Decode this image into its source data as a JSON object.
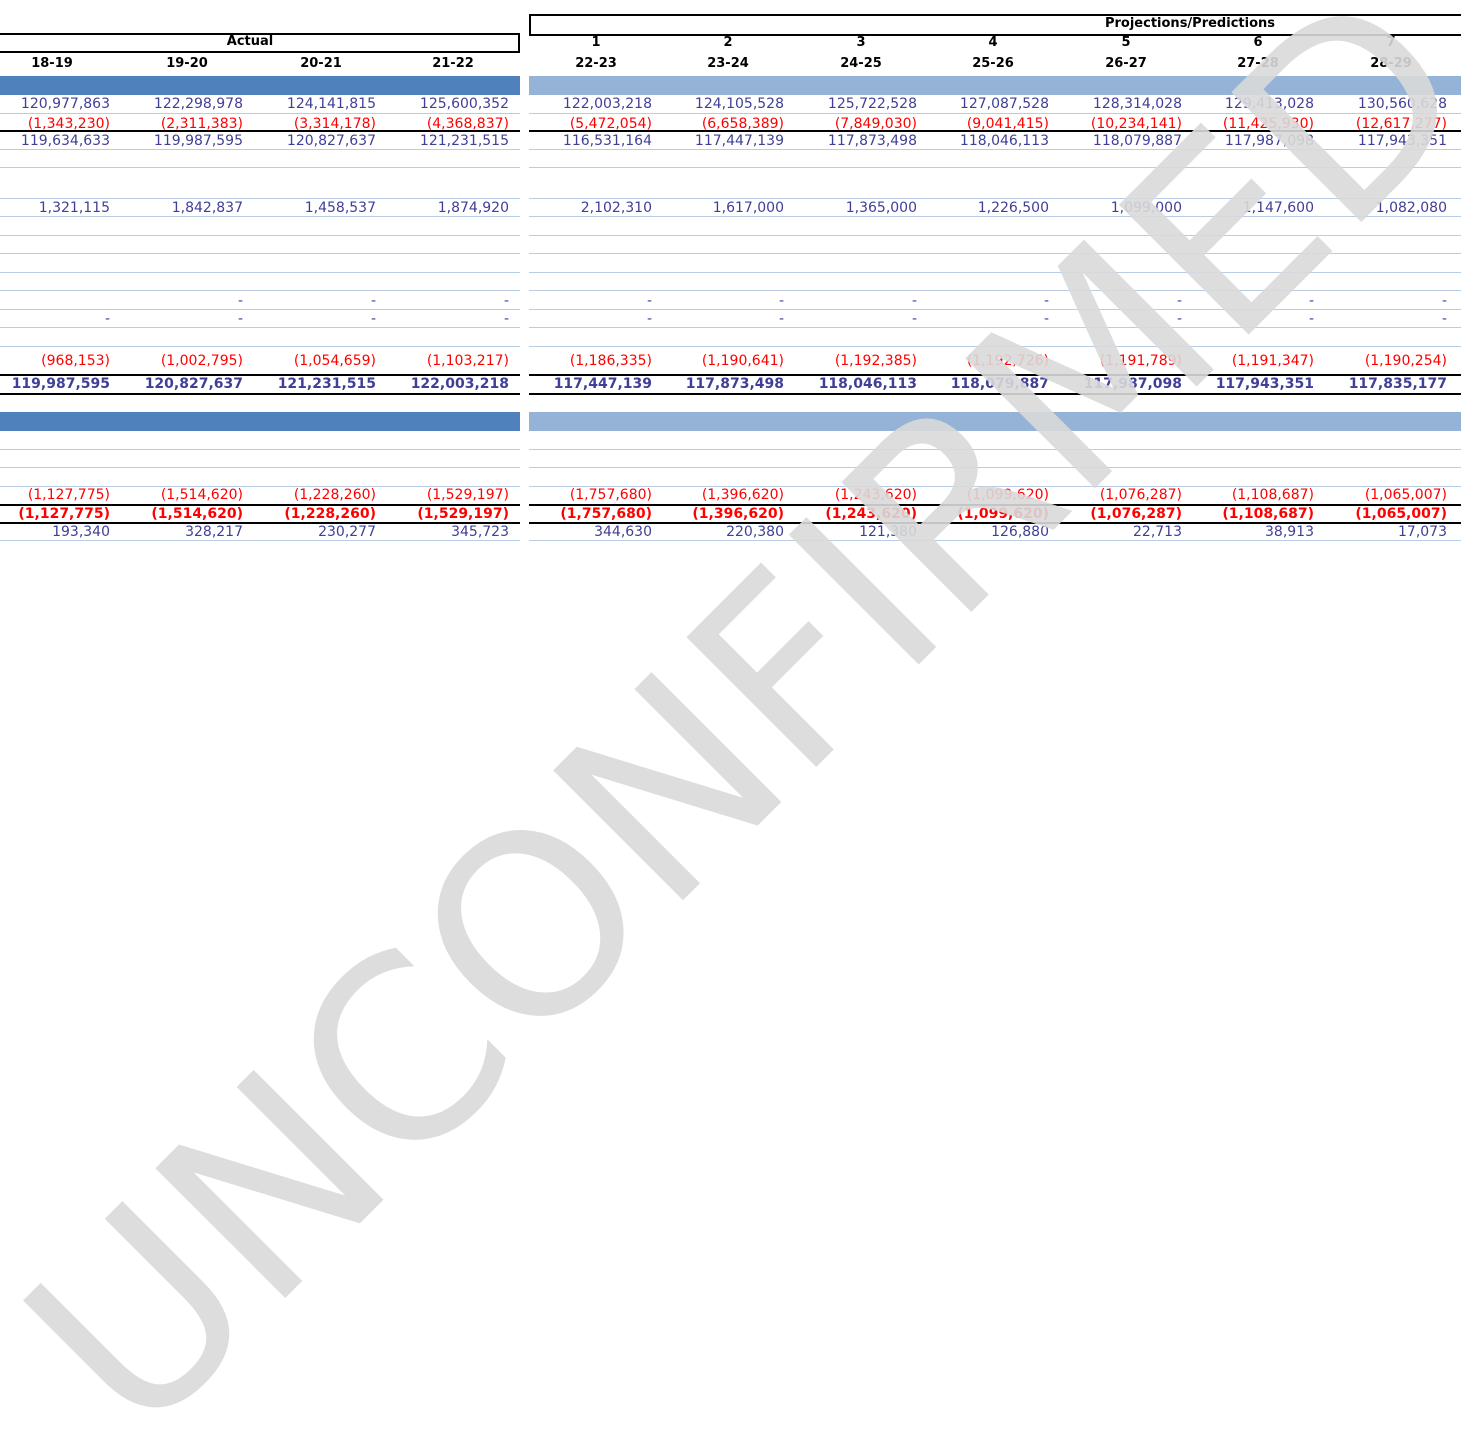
{
  "headers": {
    "actual_label": "Actual",
    "projections_label": "Projections/Predictions",
    "period_numbers": [
      "1",
      "2",
      "3",
      "4",
      "5",
      "6",
      "7"
    ],
    "years": [
      "18-19",
      "19-20",
      "20-21",
      "21-22",
      "22-23",
      "23-24",
      "24-25",
      "25-26",
      "26-27",
      "27-28",
      "28-29"
    ]
  },
  "colors": {
    "actual_band": "#4f81bd",
    "projection_band": "#95b3d7",
    "blue_text": "#3f3f97",
    "red_text": "#ff0000",
    "grid_line": "#b8cce4",
    "watermark": "#d9d9d9"
  },
  "rows": [
    {
      "style": "blue",
      "values": [
        "120,977,863",
        "122,298,978",
        "124,141,815",
        "125,600,352",
        "122,003,218",
        "124,105,528",
        "125,722,528",
        "127,087,528",
        "128,314,028",
        "129,413,028",
        "130,560,628"
      ]
    },
    {
      "style": "red",
      "values": [
        "(1,343,230)",
        "(2,311,383)",
        "(3,314,178)",
        "(4,368,837)",
        "(5,472,054)",
        "(6,658,389)",
        "(7,849,030)",
        "(9,041,415)",
        "(10,234,141)",
        "(11,425,930)",
        "(12,617,277)"
      ]
    },
    {
      "style": "blue",
      "values": [
        "119,634,633",
        "119,987,595",
        "120,827,637",
        "121,231,515",
        "116,531,164",
        "117,447,139",
        "117,873,498",
        "118,046,113",
        "118,079,887",
        "117,987,098",
        "117,943,351"
      ]
    },
    {
      "style": "blue",
      "values": [
        "1,321,115",
        "1,842,837",
        "1,458,537",
        "1,874,920",
        "2,102,310",
        "1,617,000",
        "1,365,000",
        "1,226,500",
        "1,099,000",
        "1,147,600",
        "1,082,080"
      ]
    },
    {
      "style": "blue",
      "values": [
        "",
        "-",
        "-",
        "-",
        "-",
        "-",
        "-",
        "-",
        "-",
        "-",
        "-"
      ]
    },
    {
      "style": "blue",
      "values": [
        "-",
        "-",
        "-",
        "-",
        "-",
        "-",
        "-",
        "-",
        "-",
        "-",
        "-"
      ]
    },
    {
      "style": "red",
      "values": [
        "(968,153)",
        "(1,002,795)",
        "(1,054,659)",
        "(1,103,217)",
        "(1,186,335)",
        "(1,190,641)",
        "(1,192,385)",
        "(1,192,726)",
        "(1,191,789)",
        "(1,191,347)",
        "(1,190,254)"
      ]
    },
    {
      "style": "blue-bold",
      "values": [
        "119,987,595",
        "120,827,637",
        "121,231,515",
        "122,003,218",
        "117,447,139",
        "117,873,498",
        "118,046,113",
        "118,079,887",
        "117,987,098",
        "117,943,351",
        "117,835,177"
      ]
    },
    {
      "style": "red",
      "values": [
        "(1,127,775)",
        "(1,514,620)",
        "(1,228,260)",
        "(1,529,197)",
        "(1,757,680)",
        "(1,396,620)",
        "(1,243,620)",
        "(1,099,620)",
        "(1,076,287)",
        "(1,108,687)",
        "(1,065,007)"
      ]
    },
    {
      "style": "red-bold",
      "values": [
        "(1,127,775)",
        "(1,514,620)",
        "(1,228,260)",
        "(1,529,197)",
        "(1,757,680)",
        "(1,396,620)",
        "(1,243,620)",
        "(1,099,620)",
        "(1,076,287)",
        "(1,108,687)",
        "(1,065,007)"
      ]
    },
    {
      "style": "blue",
      "values": [
        "193,340",
        "328,217",
        "230,277",
        "345,723",
        "344,630",
        "220,380",
        "121,380",
        "126,880",
        "22,713",
        "38,913",
        "17,073"
      ]
    }
  ],
  "watermark": "UNCONFIRMED"
}
